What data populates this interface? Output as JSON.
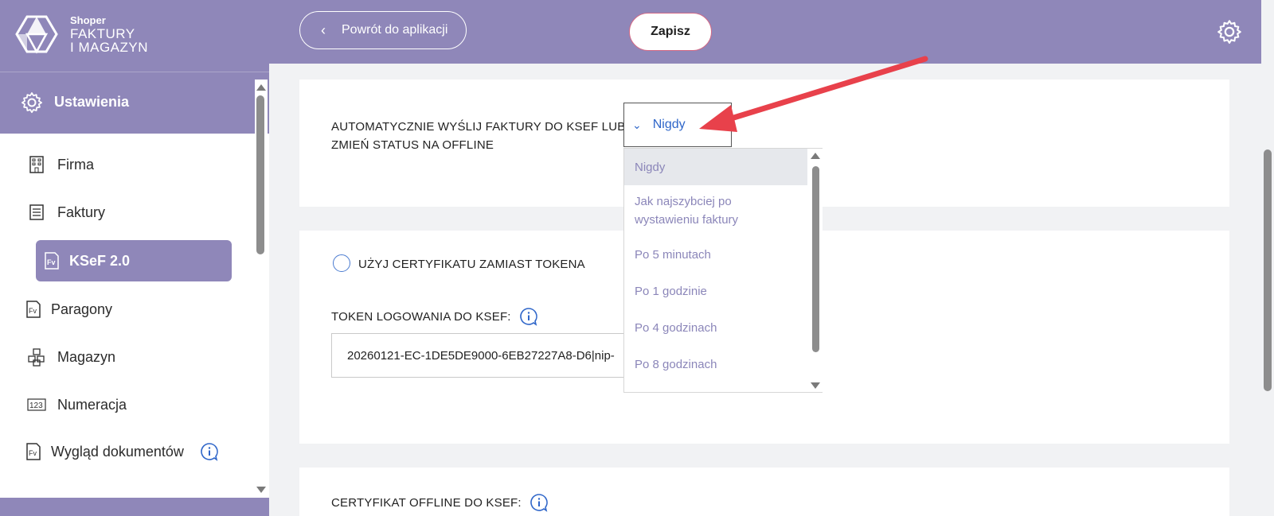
{
  "brand": {
    "small": "Shoper",
    "line1": "FAKTURY",
    "line2": "I MAGAZYN"
  },
  "sidebar": {
    "section_title": "Ustawienia",
    "items": [
      {
        "label": "Firma",
        "icon": "building-icon"
      },
      {
        "label": "Faktury",
        "icon": "document-list-icon"
      },
      {
        "label": "KSeF 2.0",
        "icon": "invoice-fv-icon",
        "active": true
      },
      {
        "label": "Paragony",
        "icon": "invoice-fv-icon"
      },
      {
        "label": "Magazyn",
        "icon": "boxes-icon"
      },
      {
        "label": "Numeracja",
        "icon": "numbers-123-icon"
      },
      {
        "label": "Wygląd dokumentów",
        "icon": "invoice-fv-icon",
        "info": true
      }
    ]
  },
  "header": {
    "back_label": "Powrót do aplikacji",
    "save_label": "Zapisz"
  },
  "auto_send": {
    "label_line1": "AUTOMATYCZNIE WYŚLIJ FAKTURY DO KSEF LUB:",
    "label_line2": "ZMIEŃ STATUS NA OFFLINE",
    "selected": "Nigdy",
    "options": [
      "Nigdy",
      "Jak najszybciej po wystawieniu faktury",
      "Po 5 minutach",
      "Po 1 godzinie",
      "Po 4 godzinach",
      "Po 8 godzinach"
    ]
  },
  "certificate": {
    "radio_label": "UŻYJ CERTYFIKATU ZAMIAST TOKENA"
  },
  "token": {
    "label": "TOKEN LOGOWANIA DO KSEF:",
    "value": "20260121-EC-1DE5DE9000-6EB27227A8-D6|nip-"
  },
  "offline_cert": {
    "label": "CERTYFIKAT OFFLINE DO KSEF:"
  },
  "colors": {
    "brand": "#8f87b9",
    "link": "#2f66c9",
    "arrow": "#e8414b",
    "save_border": "#d36a86"
  }
}
